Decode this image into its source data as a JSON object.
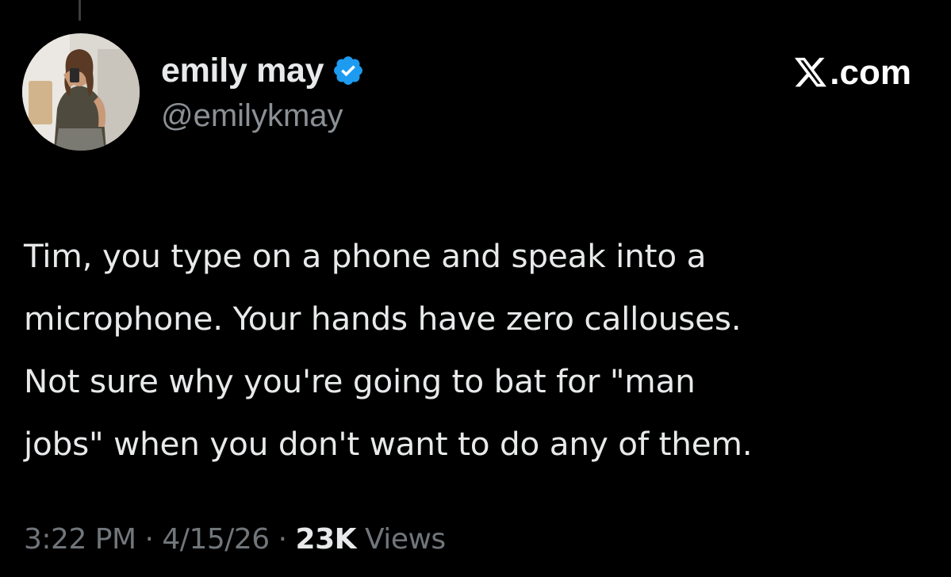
{
  "author": {
    "display_name": "emily may",
    "handle": "@emilykmay",
    "verified": true,
    "verified_color": "#1d9bf0",
    "avatar_icon": "profile-photo"
  },
  "brand": {
    "icon": "x-logo-icon",
    "suffix": ".com"
  },
  "tweet": {
    "lines": [
      "Tim, you type on a phone and speak into a",
      "microphone. Your hands have zero callouses.",
      "Not sure why you're going to bat for \"man",
      "jobs\" when you don't want to do any of them."
    ]
  },
  "meta": {
    "time": "3:22 PM",
    "separator": " · ",
    "date": "4/15/26",
    "views_count": "23K",
    "views_label": " Views"
  },
  "colors": {
    "background": "#000000",
    "text": "#e7e9ea",
    "secondary_text": "#71767b"
  }
}
